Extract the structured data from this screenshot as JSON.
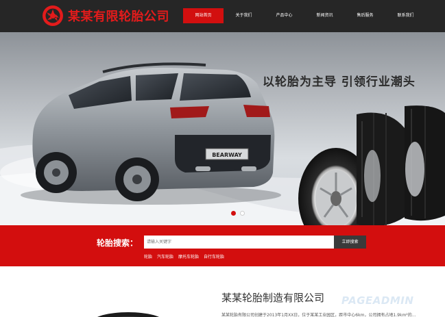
{
  "brand": {
    "name": "某某有限轮胎公司",
    "color": "#e31b1b"
  },
  "nav": {
    "items": [
      {
        "label": "网站首页",
        "active": true
      },
      {
        "label": "关于我们",
        "active": false
      },
      {
        "label": "产品中心",
        "active": false
      },
      {
        "label": "新闻资讯",
        "active": false
      },
      {
        "label": "售后服务",
        "active": false
      },
      {
        "label": "联系我们",
        "active": false
      }
    ],
    "active_color": "#d20f0f"
  },
  "banner": {
    "slogan": "以轮胎为主导  引领行业潮头",
    "license_plate": "BEARWAY",
    "tire_brand": "BEARWAY",
    "slide_count": 2,
    "active_slide": 1
  },
  "search": {
    "label": "轮胎搜索：",
    "placeholder": "请输入关键字",
    "button_label": "立即搜索",
    "hot_links": [
      "轮胎",
      "汽车轮胎",
      "摩托车轮胎",
      "自行车轮胎"
    ],
    "band_color": "#d30e0e"
  },
  "company": {
    "title": "某某轮胎制造有限公司",
    "intro": "某某轮胎有限公司创建于2013年1月XX日，位于某某工业园区，距市中心6km，公司拥有占地1.9km²的…",
    "watermark": "PAGEADMIN"
  }
}
